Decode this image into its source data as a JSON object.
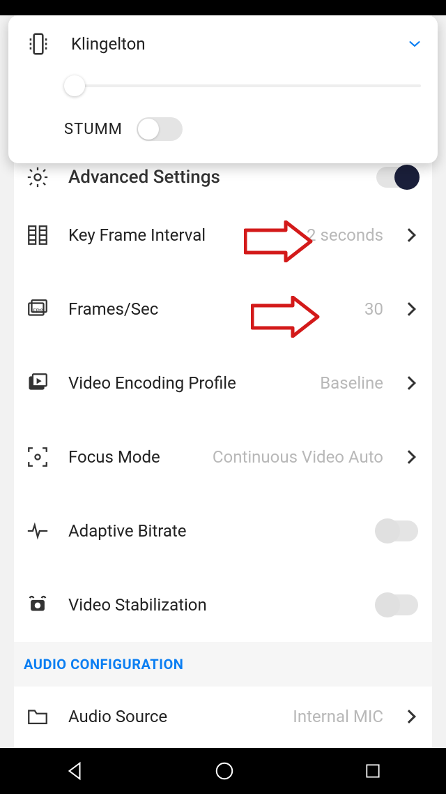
{
  "overlay": {
    "title": "Klingelton",
    "slider_value": 2,
    "mute_label": "STUMM",
    "mute_on": false
  },
  "rows": {
    "advanced": {
      "label": "Advanced Settings",
      "toggle_on": true
    },
    "kfi": {
      "label": "Key Frame Interval",
      "value": "2 seconds"
    },
    "fps": {
      "label": "Frames/Sec",
      "value": "30"
    },
    "vep": {
      "label": "Video Encoding Profile",
      "value": "Baseline"
    },
    "focus": {
      "label": "Focus Mode",
      "value": "Continuous Video Auto"
    },
    "abr": {
      "label": "Adaptive Bitrate",
      "toggle_on": false
    },
    "vstab": {
      "label": "Video Stabilization",
      "toggle_on": false
    },
    "asrc": {
      "label": "Audio Source",
      "value": "Internal MIC"
    }
  },
  "section": {
    "audio_header": "AUDIO CONFIGURATION"
  }
}
